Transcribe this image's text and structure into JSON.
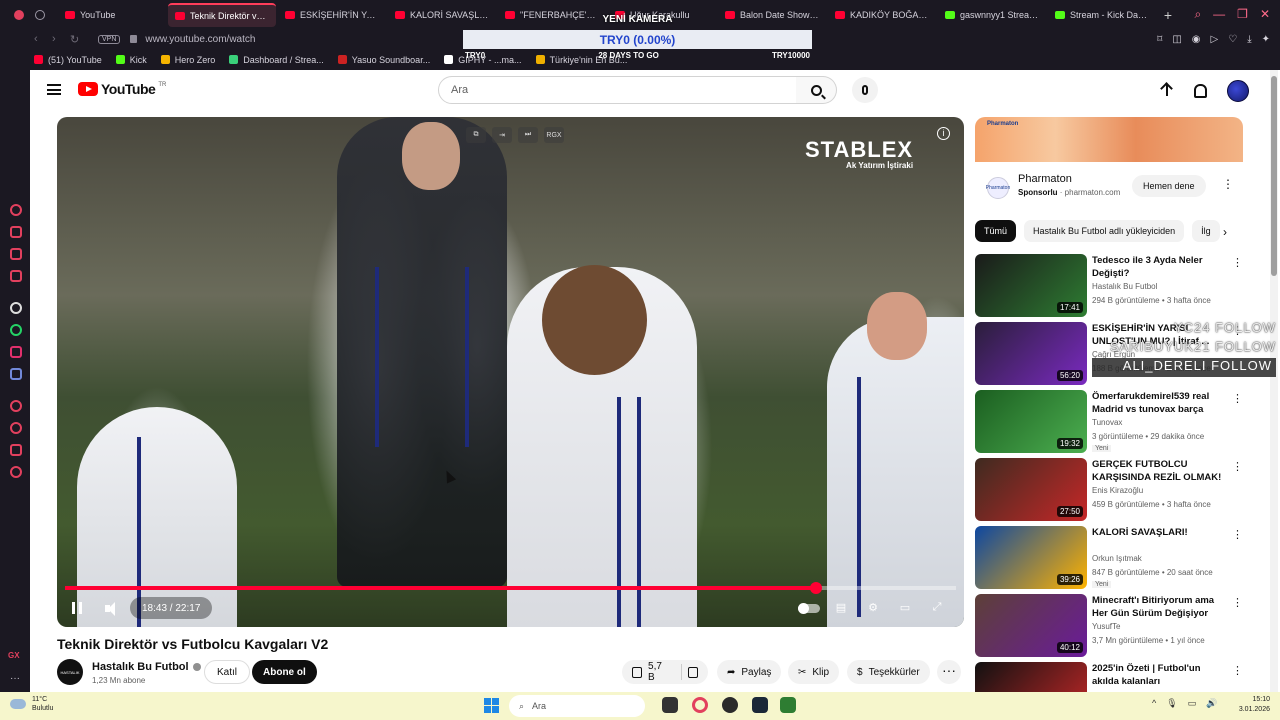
{
  "browser": {
    "tabs": [
      {
        "label": "YouTube",
        "icon": "youtube-icon",
        "active": false
      },
      {
        "label": "Teknik Direktör vs Futb",
        "icon": "youtube-icon",
        "active": true
      },
      {
        "label": "ESKİŞEHİR'İN YARIS",
        "icon": "youtube-icon",
        "active": false
      },
      {
        "label": "KALORİ SAVAŞLARI!",
        "icon": "youtube-icon",
        "active": false
      },
      {
        "label": "\"FENERBAHÇE'NİN",
        "icon": "youtube-icon",
        "active": false
      },
      {
        "label": "Uğur Karakullu",
        "icon": "youtube-icon",
        "active": false
      },
      {
        "label": "Balon Date Show 36",
        "icon": "youtube-icon",
        "active": false
      },
      {
        "label": "KADIKÖY BOĞASI ŞE",
        "icon": "youtube-icon",
        "active": false
      },
      {
        "label": "gaswnnyy1 Stream -",
        "icon": "kick-icon",
        "active": false
      },
      {
        "label": "Stream - Kick Dashbo",
        "icon": "kick-icon",
        "active": false
      }
    ],
    "url": "www.youtube.com/watch",
    "vpn_label": "VPN",
    "bookmarks": [
      {
        "label": "(51) YouTube",
        "color": "#ff0033"
      },
      {
        "label": "Kick",
        "color": "#53fc18"
      },
      {
        "label": "Hero Zero",
        "color": "#f5b400"
      },
      {
        "label": "Dashboard / Strea...",
        "color": "#3ad07a"
      },
      {
        "label": "Yasuo Soundboar...",
        "color": "#cc2222"
      },
      {
        "label": "GIPHY - ...ma...",
        "color": "#ffffff"
      },
      {
        "label": "Türkiye'nin En Bü...",
        "color": "#f0b000"
      }
    ]
  },
  "overlay": {
    "title": "YENİ KAMERA",
    "progress_text": "TRY0 (0.00%)",
    "left_label": "TRY0",
    "center_label": "28 DAYS TO GO",
    "right_label": "TRY10000"
  },
  "youtube": {
    "logo_text": "YouTube",
    "region": "TR",
    "search_placeholder": "Ara"
  },
  "player": {
    "brand_name": "STABLEX",
    "brand_sub": "Ak Yatırım İştiraki",
    "mini_label": "RGX",
    "time": "18:43 / 22:17",
    "progress": 0.843
  },
  "video": {
    "title": "Teknik Direktör vs Futbolcu Kavgaları V2",
    "channel": "Hastalık Bu Futbol",
    "channel_avatar_text": "HASTALIK",
    "subscribers": "1,23 Mn abone",
    "join_label": "Katıl",
    "subscribe_label": "Abone ol",
    "likes": "5,7 B",
    "share_label": "Paylaş",
    "clip_label": "Klip",
    "thanks_label": "Teşekkürler"
  },
  "ad": {
    "badge": "Pharmaton",
    "title": "Pharmaton",
    "sponsored": "Sponsorlu",
    "domain": "pharmaton.com",
    "cta": "Hemen dene"
  },
  "chips": [
    "Tümü",
    "Hastalık Bu Futbol adlı yükleyiciden",
    "İlg"
  ],
  "recommendations": [
    {
      "title": "Tedesco ile 3 Ayda Neler Değişti?",
      "channel": "Hastalık Bu Futbol",
      "meta": "294 B görüntüleme • 3 hafta önce",
      "duration": "17:41",
      "badge": "",
      "thumb_a": "#1a1a1a",
      "thumb_b": "#2e7d32"
    },
    {
      "title": "ESKİŞEHİR'İN YARISI UNLOST'UN MU? | İtiraf ...",
      "channel": "Çağrı Ergün",
      "meta": "188 B görüntüleme • 2 hafta önce",
      "duration": "56:20",
      "badge": "",
      "thumb_a": "#2a1e3a",
      "thumb_b": "#7a2ac0"
    },
    {
      "title": "Ömerfarukdemirel539 real Madrid vs tunovax barça",
      "channel": "Tunovax",
      "meta": "3 görüntüleme • 29 dakika önce",
      "duration": "19:32",
      "badge": "Yeni",
      "thumb_a": "#1b5e20",
      "thumb_b": "#4caf50"
    },
    {
      "title": "GERÇEK FUTBOLCU KARŞISINDA REZİL OLMAK! ...",
      "channel": "Enis Kirazoğlu",
      "meta": "459 B görüntüleme • 3 hafta önce",
      "duration": "27:50",
      "badge": "",
      "thumb_a": "#3e2a20",
      "thumb_b": "#c62828"
    },
    {
      "title": "KALORİ SAVAŞLARI!",
      "channel": "Orkun Işıtmak",
      "meta": "847 B görüntüleme • 20 saat önce",
      "duration": "39:26",
      "badge": "Yeni",
      "thumb_a": "#0d47a1",
      "thumb_b": "#ffb300"
    },
    {
      "title": "Minecraft'ı Bitiriyorum ama Her Gün Sürüm Değişiyor",
      "channel": "YusufTe",
      "meta": "3,7 Mn görüntüleme • 1 yıl önce",
      "duration": "40:12",
      "badge": "",
      "thumb_a": "#5d4037",
      "thumb_b": "#6a1b9a"
    },
    {
      "title": "2025'in Özeti | Futbol'un akılda kalanları",
      "channel": "",
      "meta": "",
      "duration": "",
      "badge": "",
      "thumb_a": "#111111",
      "thumb_b": "#c62828"
    }
  ],
  "follow_overlay": [
    "YC24 FOLLOW",
    "SARIBUYUK21 FOLLOW",
    "ALI_DERELI FOLLOW"
  ],
  "taskbar": {
    "temperature": "11°C",
    "weather": "Bulutlu",
    "search": "Ara",
    "time": "15:10",
    "date": "3.01.2026"
  }
}
